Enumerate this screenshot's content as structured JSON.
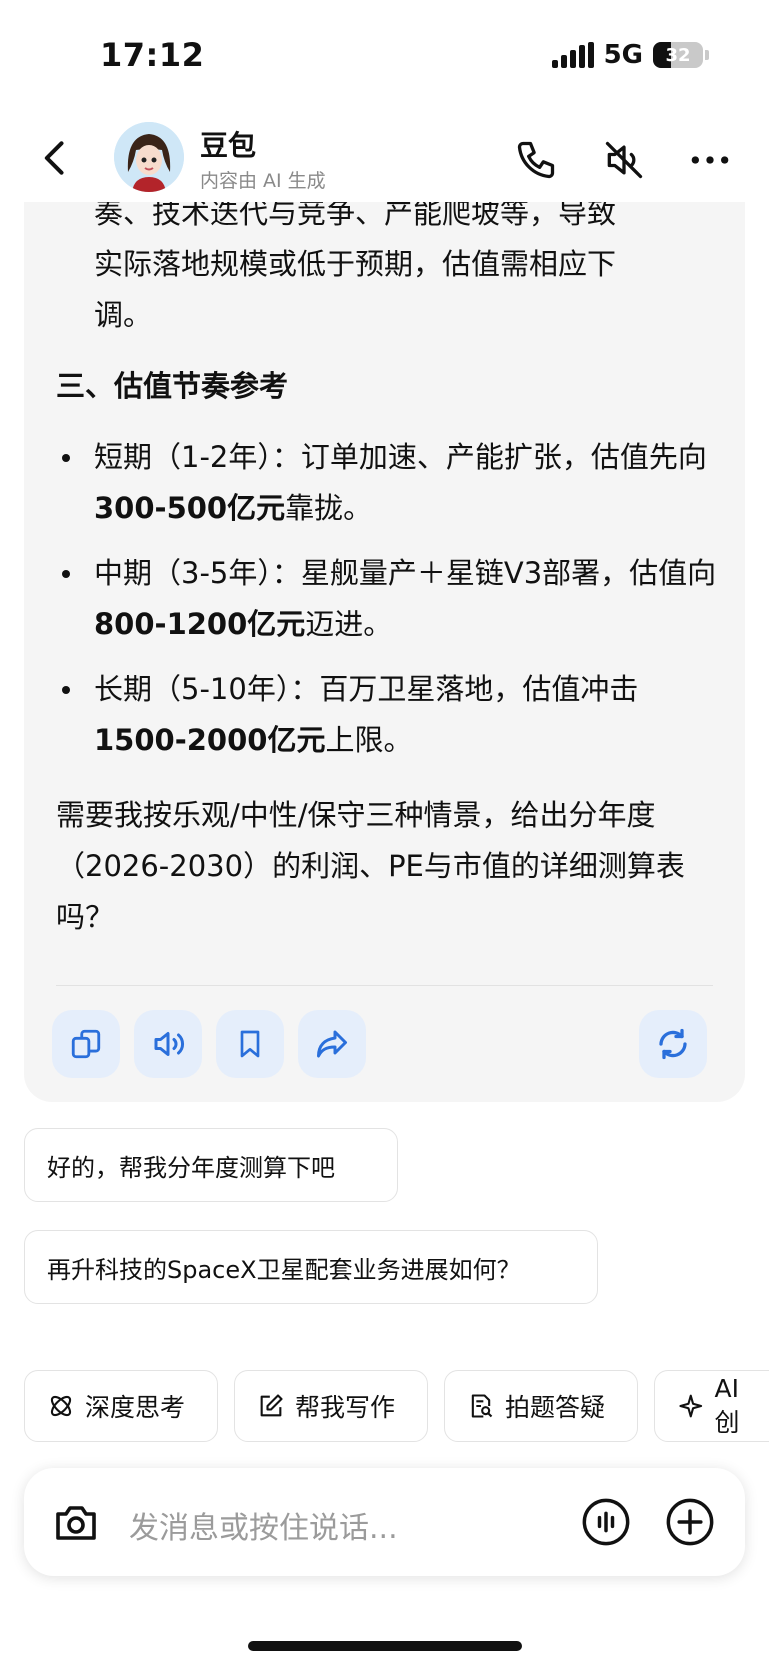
{
  "status": {
    "time": "17:12",
    "network": "5G",
    "battery": "32"
  },
  "header": {
    "name": "豆包",
    "subtitle": "内容由 AI 生成"
  },
  "message": {
    "partial_line_1": "奏、技术迭代与竞争、产能爬坡等，导致",
    "partial_line_2": "实际落地规模或低于预期，估值需相应下",
    "partial_line_3": "调。",
    "section_title": "三、估值节奏参考",
    "bullets": [
      {
        "pre": "短期（1-2年）：订单加速、产能扩张，估值先向",
        "bold": "300-500亿元",
        "post": "靠拢。"
      },
      {
        "pre": "中期（3-5年）：星舰量产＋星链V3部署，估值向",
        "bold": "800-1200亿元",
        "post": "迈进。"
      },
      {
        "pre": "长期（5-10年）：百万卫星落地，估值冲击",
        "bold": "1500-2000亿元",
        "post": "上限。"
      }
    ],
    "question": "需要我按乐观/中性/保守三种情景，给出分年度（2026-2030）的利润、PE与市值的详细测算表吗？"
  },
  "actions": [
    "copy-icon",
    "speaker-icon",
    "bookmark-icon",
    "share-icon",
    "regenerate-icon"
  ],
  "suggestions": [
    "好的，帮我分年度测算下吧",
    "再升科技的SpaceX卫星配套业务进展如何？"
  ],
  "tools": [
    "深度思考",
    "帮我写作",
    "拍题答疑",
    "AI 创"
  ],
  "input": {
    "placeholder": "发消息或按住说话..."
  },
  "colors": {
    "accent": "#2a6fdb",
    "action_bg": "#e5eefb",
    "card_bg": "#f5f5f5"
  }
}
